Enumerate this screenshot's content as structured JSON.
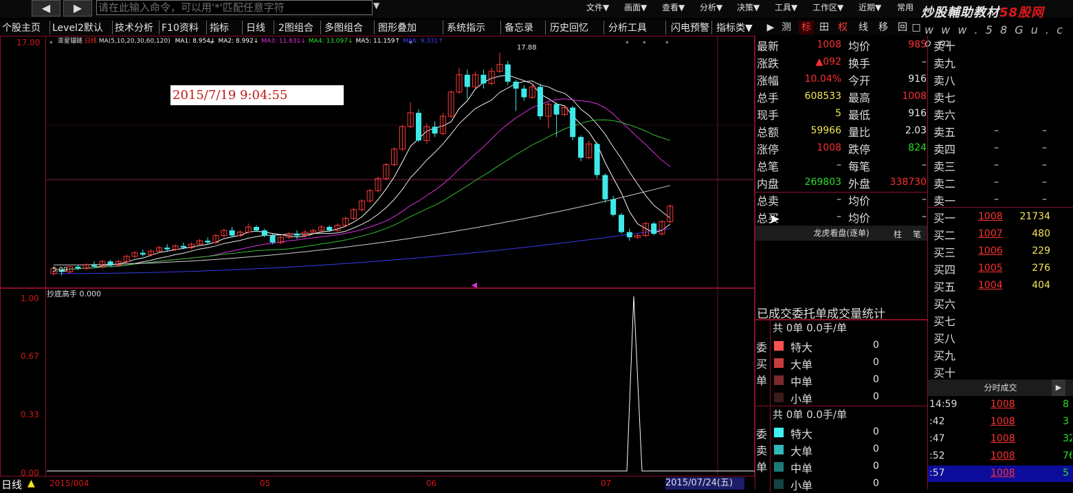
{
  "toolbar_top": {
    "back_icon": "◀",
    "forward_icon": "▶",
    "command_placeholder": "请在此输入命令，可以用'*'匹配任意字符",
    "menus": [
      "文件▼",
      "画面▼",
      "查看▼",
      "分析▼",
      "决策▼",
      "工具▼",
      "工作区▼",
      "近期▼",
      "常用"
    ]
  },
  "brand": {
    "name_part1": "炒股輔助教材",
    "name_part2": "58股网",
    "url": "w w w . 5 8 G u . c o m"
  },
  "toolbar": {
    "items": [
      "个股主页",
      "Level2默认",
      "技术分析",
      "F10资料",
      "指标",
      "日线",
      "2图组合",
      "多图组合",
      "图形叠加",
      "系统指示",
      "备忘录",
      "历史回忆",
      "分析工具",
      "闪电预警",
      "指标类▼"
    ],
    "buttons": [
      "▶",
      "测",
      "标",
      "田",
      "权",
      "线",
      "移",
      "回",
      "□"
    ]
  },
  "chart": {
    "stock_name": "亚星锚链",
    "period_label": "日线",
    "ma_params": "MA(5,10,20,30,60,120)",
    "ma_values": [
      {
        "label": "MA1: 8.954↓",
        "color": "#ffffff"
      },
      {
        "label": "MA2: 8.992↓",
        "color": "#ffffff"
      },
      {
        "label": "MA3: 11.631↓",
        "color": "#e030e0"
      },
      {
        "label": "MA4: 13.097↓",
        "color": "#30e030"
      },
      {
        "label": "MA5: 11.159↑",
        "color": "#ffffff"
      },
      {
        "label": "MA6: 9.331↑",
        "color": "#4040ff"
      }
    ],
    "top_ylabel": "17.00",
    "high_label": "17.88",
    "low_label": "5.00",
    "timestamp": "2015/7/19 9:04:55",
    "indicator_name": "抄底高手 0.000",
    "indicator_yticks": [
      "1.00",
      "0.67",
      "0.33",
      "0.00"
    ],
    "x_labels": [
      "2015/004",
      "05",
      "06",
      "07"
    ],
    "date_label": "2015/07/24(五)",
    "bottom_period": "日线"
  },
  "chart_data": {
    "type": "candlestick",
    "candles": [
      [
        5.1,
        5.4,
        5.0,
        5.3
      ],
      [
        5.3,
        5.2,
        5.0,
        5.4
      ],
      [
        5.2,
        5.5,
        5.1,
        5.5
      ],
      [
        5.5,
        5.4,
        5.3,
        5.6
      ],
      [
        5.4,
        5.6,
        5.3,
        5.7
      ],
      [
        5.6,
        5.5,
        5.4,
        5.8
      ],
      [
        5.5,
        5.8,
        5.4,
        5.9
      ],
      [
        5.8,
        5.6,
        5.5,
        5.9
      ],
      [
        5.6,
        5.8,
        5.5,
        5.9
      ],
      [
        5.8,
        6.1,
        5.7,
        6.2
      ],
      [
        6.1,
        6.3,
        6.0,
        6.4
      ],
      [
        6.3,
        6.2,
        6.1,
        6.5
      ],
      [
        6.2,
        6.4,
        6.1,
        6.5
      ],
      [
        6.4,
        6.6,
        6.3,
        6.7
      ],
      [
        6.6,
        6.5,
        6.4,
        6.8
      ],
      [
        6.5,
        6.7,
        6.4,
        6.8
      ],
      [
        6.7,
        6.6,
        6.5,
        6.9
      ],
      [
        6.6,
        6.8,
        6.5,
        6.9
      ],
      [
        6.8,
        7.0,
        6.7,
        7.1
      ],
      [
        7.0,
        6.9,
        6.8,
        7.2
      ],
      [
        6.9,
        7.3,
        6.8,
        7.4
      ],
      [
        7.3,
        7.6,
        7.2,
        7.7
      ],
      [
        7.6,
        7.3,
        7.2,
        7.8
      ],
      [
        7.3,
        7.5,
        7.2,
        7.6
      ],
      [
        7.5,
        7.8,
        7.4,
        8.0
      ],
      [
        7.8,
        7.6,
        7.5,
        7.9
      ],
      [
        7.6,
        7.3,
        7.2,
        7.7
      ],
      [
        7.3,
        6.9,
        6.8,
        7.4
      ],
      [
        6.9,
        7.2,
        6.8,
        7.3
      ],
      [
        7.2,
        7.4,
        7.1,
        7.5
      ],
      [
        7.4,
        7.3,
        7.1,
        7.6
      ],
      [
        7.3,
        7.5,
        7.2,
        7.6
      ],
      [
        7.5,
        7.6,
        7.4,
        7.7
      ],
      [
        7.6,
        7.8,
        7.5,
        7.9
      ],
      [
        7.8,
        7.6,
        7.5,
        7.9
      ],
      [
        7.6,
        7.9,
        7.5,
        8.0
      ],
      [
        7.9,
        8.3,
        7.8,
        8.4
      ],
      [
        8.3,
        8.8,
        8.2,
        8.9
      ],
      [
        8.8,
        9.3,
        8.7,
        9.4
      ],
      [
        9.3,
        9.9,
        9.2,
        10.0
      ],
      [
        9.9,
        10.6,
        9.8,
        10.7
      ],
      [
        10.6,
        11.4,
        10.5,
        11.5
      ],
      [
        11.4,
        12.3,
        11.3,
        12.4
      ],
      [
        12.3,
        13.6,
        12.2,
        13.7
      ],
      [
        13.6,
        14.4,
        13.5,
        15.0
      ],
      [
        14.4,
        12.8,
        12.7,
        14.6
      ],
      [
        12.8,
        13.6,
        12.6,
        13.8
      ],
      [
        13.6,
        13.2,
        13.0,
        13.9
      ],
      [
        13.2,
        14.2,
        13.1,
        14.4
      ],
      [
        14.2,
        15.6,
        14.1,
        15.7
      ],
      [
        15.6,
        16.6,
        15.5,
        17.0
      ],
      [
        16.6,
        15.9,
        15.2,
        16.9
      ],
      [
        15.9,
        16.6,
        15.8,
        16.8
      ],
      [
        16.6,
        16.1,
        15.8,
        16.9
      ],
      [
        16.1,
        16.8,
        16.0,
        17.0
      ],
      [
        16.8,
        17.2,
        16.7,
        17.88
      ],
      [
        17.2,
        16.2,
        16.0,
        17.4
      ],
      [
        16.2,
        15.8,
        14.5,
        16.3
      ],
      [
        15.8,
        15.3,
        15.1,
        16.0
      ],
      [
        15.3,
        15.9,
        15.2,
        16.1
      ],
      [
        15.9,
        14.2,
        14.0,
        16.1
      ],
      [
        14.2,
        14.9,
        13.5,
        15.0
      ],
      [
        14.9,
        14.3,
        13.0,
        15.0
      ],
      [
        14.3,
        14.7,
        14.2,
        14.8
      ],
      [
        14.7,
        13.0,
        12.8,
        14.8
      ],
      [
        13.0,
        11.8,
        11.6,
        13.1
      ],
      [
        11.8,
        12.6,
        11.7,
        12.8
      ],
      [
        12.6,
        10.8,
        10.6,
        12.7
      ],
      [
        10.8,
        9.4,
        9.2,
        10.9
      ],
      [
        9.4,
        8.5,
        8.4,
        9.6
      ],
      [
        8.5,
        7.5,
        7.4,
        8.6
      ],
      [
        7.5,
        7.2,
        7.0,
        7.7
      ],
      [
        7.2,
        7.3,
        7.1,
        7.4
      ],
      [
        7.3,
        8.0,
        7.2,
        8.1
      ],
      [
        8.0,
        7.4,
        7.3,
        8.1
      ],
      [
        7.4,
        8.1,
        7.3,
        8.2
      ],
      [
        8.1,
        9.0,
        8.0,
        9.1
      ]
    ],
    "indicator": {
      "name": "抄底高手",
      "peak_value": 1.0
    }
  },
  "quote": {
    "rows": [
      {
        "l1": "最新",
        "v1": "1008",
        "c1": "red",
        "l2": "均价",
        "v2": "985",
        "c2": "red"
      },
      {
        "l1": "涨跌",
        "v1": "▲092",
        "c1": "red",
        "l2": "换手",
        "v2": "–",
        "c2": "wht"
      },
      {
        "l1": "涨幅",
        "v1": "10.04%",
        "c1": "red",
        "l2": "今开",
        "v2": "916",
        "c2": "wht"
      },
      {
        "l1": "总手",
        "v1": "608533",
        "c1": "yel",
        "l2": "最高",
        "v2": "1008",
        "c2": "red"
      },
      {
        "l1": "现手",
        "v1": "5",
        "c1": "yel",
        "l2": "最低",
        "v2": "916",
        "c2": "wht"
      },
      {
        "l1": "总额",
        "v1": "59966",
        "c1": "yel",
        "l2": "量比",
        "v2": "2.03",
        "c2": "wht"
      },
      {
        "l1": "涨停",
        "v1": "1008",
        "c1": "red",
        "l2": "跌停",
        "v2": "824",
        "c2": "grn"
      },
      {
        "l1": "总笔",
        "v1": "–",
        "c1": "wht",
        "l2": "每笔",
        "v2": "–",
        "c2": "wht"
      },
      {
        "l1": "内盘",
        "v1": "269803",
        "c1": "grn",
        "l2": "外盘",
        "v2": "338730",
        "c2": "red"
      },
      {
        "l1": "总卖",
        "v1": "–",
        "c1": "wht",
        "l2": "均价",
        "v2": "–",
        "c2": "wht"
      },
      {
        "l1": "总买",
        "v1": "–",
        "c1": "wht",
        "l2": "均价",
        "v2": "–",
        "c2": "wht"
      }
    ],
    "dragon_tiger": "龙虎看盘(逐单)",
    "dt_btn1": "柱",
    "dt_btn2": "笔",
    "stats_title": "已成交委托单成交量统计",
    "buy_group": {
      "total": "共 0单 0.0手/单",
      "label": "委买单",
      "rows": [
        {
          "name": "特大",
          "val": "0",
          "color": "#ff5050"
        },
        {
          "name": "大单",
          "val": "0",
          "color": "#c83c3c"
        },
        {
          "name": "中单",
          "val": "0",
          "color": "#7a2a2a"
        },
        {
          "name": "小单",
          "val": "0",
          "color": "#3a1a1a"
        }
      ]
    },
    "sell_group": {
      "total": "共 0单 0.0手/单",
      "label": "委卖单",
      "rows": [
        {
          "name": "特大",
          "val": "0",
          "color": "#40f0f0"
        },
        {
          "name": "大单",
          "val": "0",
          "color": "#30b8b8"
        },
        {
          "name": "中单",
          "val": "0",
          "color": "#1f7878"
        },
        {
          "name": "小单",
          "val": "0",
          "color": "#124444"
        }
      ]
    }
  },
  "orderbook": {
    "sells": [
      {
        "l": "卖十",
        "p": "",
        "v": ""
      },
      {
        "l": "卖九",
        "p": "",
        "v": ""
      },
      {
        "l": "卖八",
        "p": "",
        "v": ""
      },
      {
        "l": "卖七",
        "p": "",
        "v": ""
      },
      {
        "l": "卖六",
        "p": "",
        "v": ""
      },
      {
        "l": "卖五",
        "p": "–",
        "v": "–"
      },
      {
        "l": "卖四",
        "p": "–",
        "v": "–"
      },
      {
        "l": "卖三",
        "p": "–",
        "v": "–"
      },
      {
        "l": "卖二",
        "p": "–",
        "v": "–"
      },
      {
        "l": "卖一",
        "p": "–",
        "v": "–"
      }
    ],
    "buys": [
      {
        "l": "买一",
        "p": "1008",
        "v": "21734"
      },
      {
        "l": "买二",
        "p": "1007",
        "v": "480"
      },
      {
        "l": "买三",
        "p": "1006",
        "v": "229"
      },
      {
        "l": "买四",
        "p": "1005",
        "v": "276"
      },
      {
        "l": "买五",
        "p": "1004",
        "v": "404"
      },
      {
        "l": "买六",
        "p": "",
        "v": ""
      },
      {
        "l": "买七",
        "p": "",
        "v": ""
      },
      {
        "l": "买八",
        "p": "",
        "v": ""
      },
      {
        "l": "买九",
        "p": "",
        "v": ""
      },
      {
        "l": "买十",
        "p": "",
        "v": ""
      }
    ],
    "ticks_title": "分时成交",
    "ticks": [
      {
        "t": "14:59",
        "p": "1008",
        "v": "8"
      },
      {
        "t": ":42",
        "p": "1008",
        "v": "3"
      },
      {
        "t": ":47",
        "p": "1008",
        "v": "32"
      },
      {
        "t": ":52",
        "p": "1008",
        "v": "76"
      },
      {
        "t": ":57",
        "p": "1008",
        "v": "5"
      }
    ]
  }
}
